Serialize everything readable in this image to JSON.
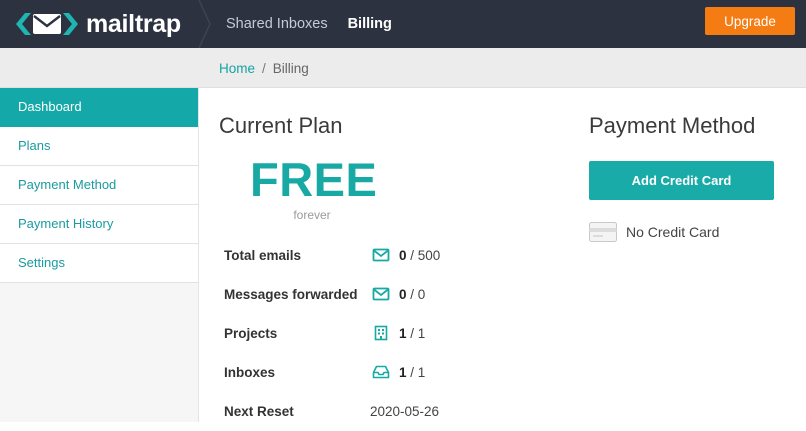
{
  "app": {
    "logo_text": "mailtrap"
  },
  "nav": {
    "items": [
      {
        "label": "Shared Inboxes"
      },
      {
        "label": "Billing"
      }
    ],
    "upgrade_label": "Upgrade"
  },
  "breadcrumb": {
    "home": "Home",
    "separator": "/",
    "current": "Billing"
  },
  "sidebar": {
    "items": [
      {
        "label": "Dashboard",
        "active": true
      },
      {
        "label": "Plans"
      },
      {
        "label": "Payment Method"
      },
      {
        "label": "Payment History"
      },
      {
        "label": "Settings"
      }
    ]
  },
  "current_plan": {
    "heading": "Current Plan",
    "name": "FREE",
    "term": "forever",
    "usage": [
      {
        "label": "Total emails",
        "icon": "envelope-icon",
        "used": "0",
        "limit": "/ 500"
      },
      {
        "label": "Messages forwarded",
        "icon": "envelope-icon",
        "used": "0",
        "limit": "/ 0"
      },
      {
        "label": "Projects",
        "icon": "building-icon",
        "used": "1",
        "limit": "/ 1"
      },
      {
        "label": "Inboxes",
        "icon": "inbox-icon",
        "used": "1",
        "limit": "/ 1"
      }
    ],
    "next_reset_label": "Next Reset",
    "next_reset_value": "2020-05-26"
  },
  "payment": {
    "heading": "Payment Method",
    "add_card_label": "Add Credit Card",
    "card_status": "No Credit Card",
    "card_icon": "credit-card-icon"
  },
  "colors": {
    "topbar": "#2d3241",
    "accent": "#18a9a5",
    "upgrade": "#f57c13"
  }
}
